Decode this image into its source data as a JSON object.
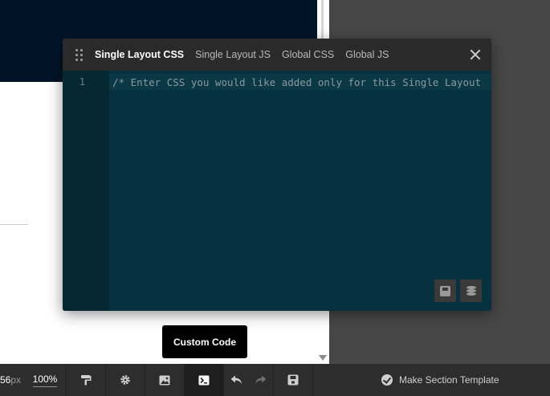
{
  "editor_modal": {
    "tabs": [
      {
        "label": "Single Layout CSS",
        "active": true
      },
      {
        "label": "Single Layout JS",
        "active": false
      },
      {
        "label": "Global CSS",
        "active": false
      },
      {
        "label": "Global JS",
        "active": false
      }
    ],
    "line_number": "1",
    "code_placeholder": "/* Enter CSS you would like added only for this Single Layout"
  },
  "tooltip": {
    "text": "Custom Code"
  },
  "toolbar": {
    "width_value": "56",
    "width_unit": "px",
    "zoom": "100%",
    "make_template_label": "Make Section Template"
  },
  "colors": {
    "editor_bg": "#07313e",
    "header_bg": "#2a2a2a",
    "toolbar_bg": "#2d2d2d",
    "hero_bg": "#001428"
  }
}
